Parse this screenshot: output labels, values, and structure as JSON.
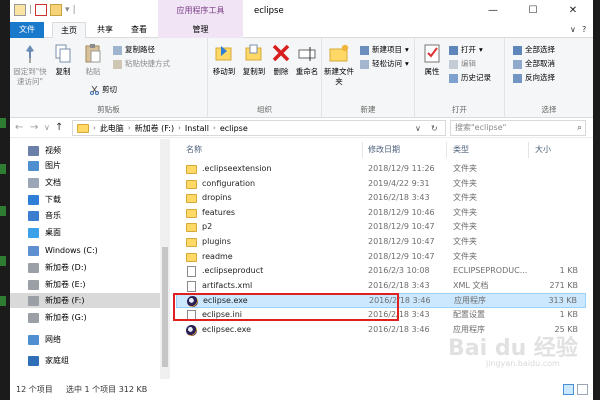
{
  "window": {
    "context_tab": "应用程序工具",
    "title": "eclipse",
    "controls": {
      "minimize": "—",
      "maximize": "☐",
      "close": "✕"
    }
  },
  "ribbon_tabs": [
    "文件",
    "主页",
    "共享",
    "查看",
    "管理"
  ],
  "ribbon_right": {
    "collapse": "∨",
    "help": "?"
  },
  "ribbon": {
    "clipboard": {
      "pin": "固定到\"快速访问\"",
      "copy": "复制",
      "paste": "粘贴",
      "copy_path": "复制路径",
      "paste_shortcut": "粘贴快捷方式",
      "cut": "剪切",
      "label": "剪贴板"
    },
    "organize": {
      "move_to": "移动到",
      "copy_to": "复制到",
      "delete": "删除",
      "rename": "重命名",
      "label": "组织"
    },
    "new": {
      "new_folder": "新建文件夹",
      "new_item": "新建项目",
      "easy_access": "轻松访问",
      "label": "新建"
    },
    "open": {
      "properties": "属性",
      "open": "打开",
      "edit": "编辑",
      "history": "历史记录",
      "label": "打开"
    },
    "select": {
      "select_all": "全部选择",
      "select_none": "全部取消",
      "invert": "反向选择",
      "label": "选择"
    }
  },
  "address": {
    "nav": {
      "back": "←",
      "forward": "→",
      "up_menu": "∨",
      "up": "↑"
    },
    "crumbs": [
      "此电脑",
      "新加卷 (F:)",
      "Install",
      "eclipse"
    ],
    "search_placeholder": "搜索\"eclipse\""
  },
  "nav_pane": [
    {
      "label": "视频",
      "color": "#6b7fa8"
    },
    {
      "label": "图片",
      "color": "#4f8fcf"
    },
    {
      "label": "文档",
      "color": "#9aa5b6"
    },
    {
      "label": "下载",
      "color": "#2f7fd6"
    },
    {
      "label": "音乐",
      "color": "#3b7ed0"
    },
    {
      "label": "桌面",
      "color": "#3aa0e8"
    },
    {
      "label": "Windows (C:)",
      "color": "#5e8fd1"
    },
    {
      "label": "新加卷 (D:)",
      "color": "#9aa0a6"
    },
    {
      "label": "新加卷 (E:)",
      "color": "#9aa0a6"
    },
    {
      "label": "新加卷 (F:)",
      "color": "#9aa0a6",
      "selected": true
    },
    {
      "label": "新加卷 (G:)",
      "color": "#9aa0a6"
    },
    {
      "label": "网络",
      "color": "#4f8fcf"
    },
    {
      "label": "家庭组",
      "color": "#2f6fb8"
    }
  ],
  "columns": {
    "name": "名称",
    "modified": "修改日期",
    "type": "类型",
    "size": "大小"
  },
  "files": [
    {
      "name": ".eclipseextension",
      "modified": "2018/12/9 11:26",
      "type": "文件夹",
      "size": "",
      "icon": "folder"
    },
    {
      "name": "configuration",
      "modified": "2019/4/22 9:31",
      "type": "文件夹",
      "size": "",
      "icon": "folder"
    },
    {
      "name": "dropins",
      "modified": "2016/2/18 3:43",
      "type": "文件夹",
      "size": "",
      "icon": "folder"
    },
    {
      "name": "features",
      "modified": "2018/12/9 10:46",
      "type": "文件夹",
      "size": "",
      "icon": "folder"
    },
    {
      "name": "p2",
      "modified": "2018/12/9 10:47",
      "type": "文件夹",
      "size": "",
      "icon": "folder"
    },
    {
      "name": "plugins",
      "modified": "2018/12/9 10:47",
      "type": "文件夹",
      "size": "",
      "icon": "folder"
    },
    {
      "name": "readme",
      "modified": "2018/12/9 10:47",
      "type": "文件夹",
      "size": "",
      "icon": "folder"
    },
    {
      "name": ".eclipseproduct",
      "modified": "2016/2/3 10:08",
      "type": "ECLIPSEPRODUC...",
      "size": "1 KB",
      "icon": "doc"
    },
    {
      "name": "artifacts.xml",
      "modified": "2016/2/18 3:43",
      "type": "XML 文档",
      "size": "271 KB",
      "icon": "doc"
    },
    {
      "name": "eclipse.exe",
      "modified": "2016/2/18 3:46",
      "type": "应用程序",
      "size": "313 KB",
      "icon": "exe",
      "selected": true
    },
    {
      "name": "eclipse.ini",
      "modified": "2016/2/18 3:43",
      "type": "配置设置",
      "size": "1 KB",
      "icon": "doc"
    },
    {
      "name": "eclipsec.exe",
      "modified": "2016/2/18 3:46",
      "type": "应用程序",
      "size": "25 KB",
      "icon": "exe"
    }
  ],
  "status": {
    "count": "12 个项目",
    "selection": "选中 1 个项目  312 KB"
  },
  "watermark": {
    "main": "Bai du 经验",
    "sub": "jingyan.baidu.com"
  }
}
